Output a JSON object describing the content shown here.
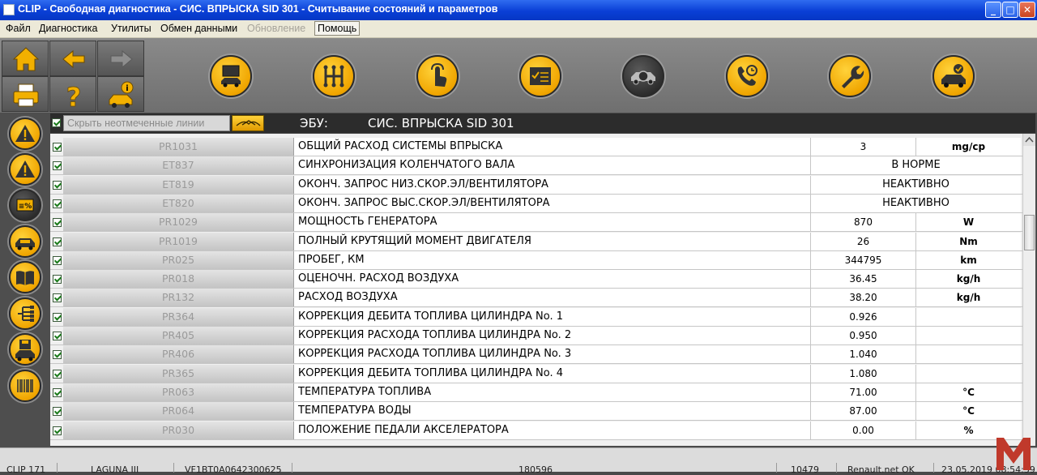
{
  "window": {
    "title": "CLIP - Свободная диагностика - СИС. ВПРЫСКА SID 301 - Считывание состояний и параметров",
    "minimize": "_",
    "maximize": "□",
    "close": "✕"
  },
  "menu": [
    {
      "label": "Файл"
    },
    {
      "label": "Диагностика"
    },
    {
      "label": "Утилиты"
    },
    {
      "label": "Обмен данными"
    },
    {
      "label": "Обновление"
    },
    {
      "label": "Помощь"
    }
  ],
  "toolbar": {
    "left_buttons": [
      "home-icon",
      "back-arrow-icon",
      "forward-arrow-icon",
      "print-icon",
      "help-icon",
      "vehicle-info-icon"
    ],
    "main_buttons": [
      "vehicle-screen-icon",
      "gearbox-icon",
      "touch-icon",
      "checklist-icon",
      "vehicle-diagnostic-icon",
      "phone-support-icon",
      "wrench-icon",
      "vehicle-check-icon"
    ]
  },
  "sidebar": {
    "buttons": [
      "warning-icon",
      "warning-icon",
      "parameters-icon",
      "vehicle-icon",
      "manual-book-icon",
      "tree-icon",
      "vehicle-save-icon",
      "barcode-icon"
    ]
  },
  "header": {
    "hide_unchecked_label": "Скрыть неотмеченные линии",
    "ecu_label": "ЭБУ:",
    "ecu_name": "СИС. ВПРЫСКА SID 301"
  },
  "table": {
    "rows": [
      {
        "code": "PR1031",
        "name": "ОБЩИЙ РАСХОД СИСТЕМЫ ВПРЫСКА",
        "value": "3",
        "unit": "mg/cp"
      },
      {
        "code": "ET837",
        "name": "СИНХРОНИЗАЦИЯ КОЛЕНЧАТОГО ВАЛА",
        "state": "В НОРМЕ"
      },
      {
        "code": "ET819",
        "name": "ОКОНЧ. ЗАПРОС НИЗ.СКОР.ЭЛ/ВЕНТИЛЯТОРА",
        "state": "НЕАКТИВНО"
      },
      {
        "code": "ET820",
        "name": "ОКОНЧ. ЗАПРОС ВЫС.СКОР.ЭЛ/ВЕНТИЛЯТОРА",
        "state": "НЕАКТИВНО"
      },
      {
        "code": "PR1029",
        "name": "МОЩНОСТЬ ГЕНЕРАТОРА",
        "value": "870",
        "unit": "W"
      },
      {
        "code": "PR1019",
        "name": "ПОЛНЫЙ КРУТЯЩИЙ МОМЕНТ ДВИГАТЕЛЯ",
        "value": "26",
        "unit": "Nm"
      },
      {
        "code": "PR025",
        "name": "ПРОБЕГ, КМ",
        "value": "344795",
        "unit": "km"
      },
      {
        "code": "PR018",
        "name": "ОЦЕНОЧН. РАСХОД ВОЗДУХА",
        "value": "36.45",
        "unit": "kg/h"
      },
      {
        "code": "PR132",
        "name": "РАСХОД ВОЗДУХА",
        "value": "38.20",
        "unit": "kg/h"
      },
      {
        "code": "PR364",
        "name": "КОРРЕКЦИЯ ДЕБИТА ТОПЛИВА ЦИЛИНДРА No. 1",
        "value": "0.926",
        "unit": ""
      },
      {
        "code": "PR405",
        "name": "КОРРЕКЦИЯ РАСХОДА ТОПЛИВА ЦИЛИНДРА No. 2",
        "value": "0.950",
        "unit": ""
      },
      {
        "code": "PR406",
        "name": "КОРРЕКЦИЯ РАСХОДА ТОПЛИВА ЦИЛИНДРА No. 3",
        "value": "1.040",
        "unit": ""
      },
      {
        "code": "PR365",
        "name": "КОРРЕКЦИЯ ДЕБИТА ТОПЛИВА ЦИЛИНДРА No. 4",
        "value": "1.080",
        "unit": ""
      },
      {
        "code": "PR063",
        "name": "ТЕМПЕРАТУРА ТОПЛИВА",
        "value": "71.00",
        "unit": "°C"
      },
      {
        "code": "PR064",
        "name": "ТЕМПЕРАТУРА ВОДЫ",
        "value": "87.00",
        "unit": "°C"
      },
      {
        "code": "PR030",
        "name": "ПОЛОЖЕНИЕ ПЕДАЛИ АКСЕЛЕРАТОРА",
        "value": "0.00",
        "unit": "%"
      }
    ]
  },
  "statusbar": {
    "items": [
      "CLIP 171",
      "LAGUNA III",
      "VF1BT0A0642300625",
      "180596",
      "10479",
      "Renault.net OK",
      "23.05.2019 08:54:39"
    ]
  },
  "watermark": {
    "letter": "M",
    "color": "#c0392b"
  }
}
